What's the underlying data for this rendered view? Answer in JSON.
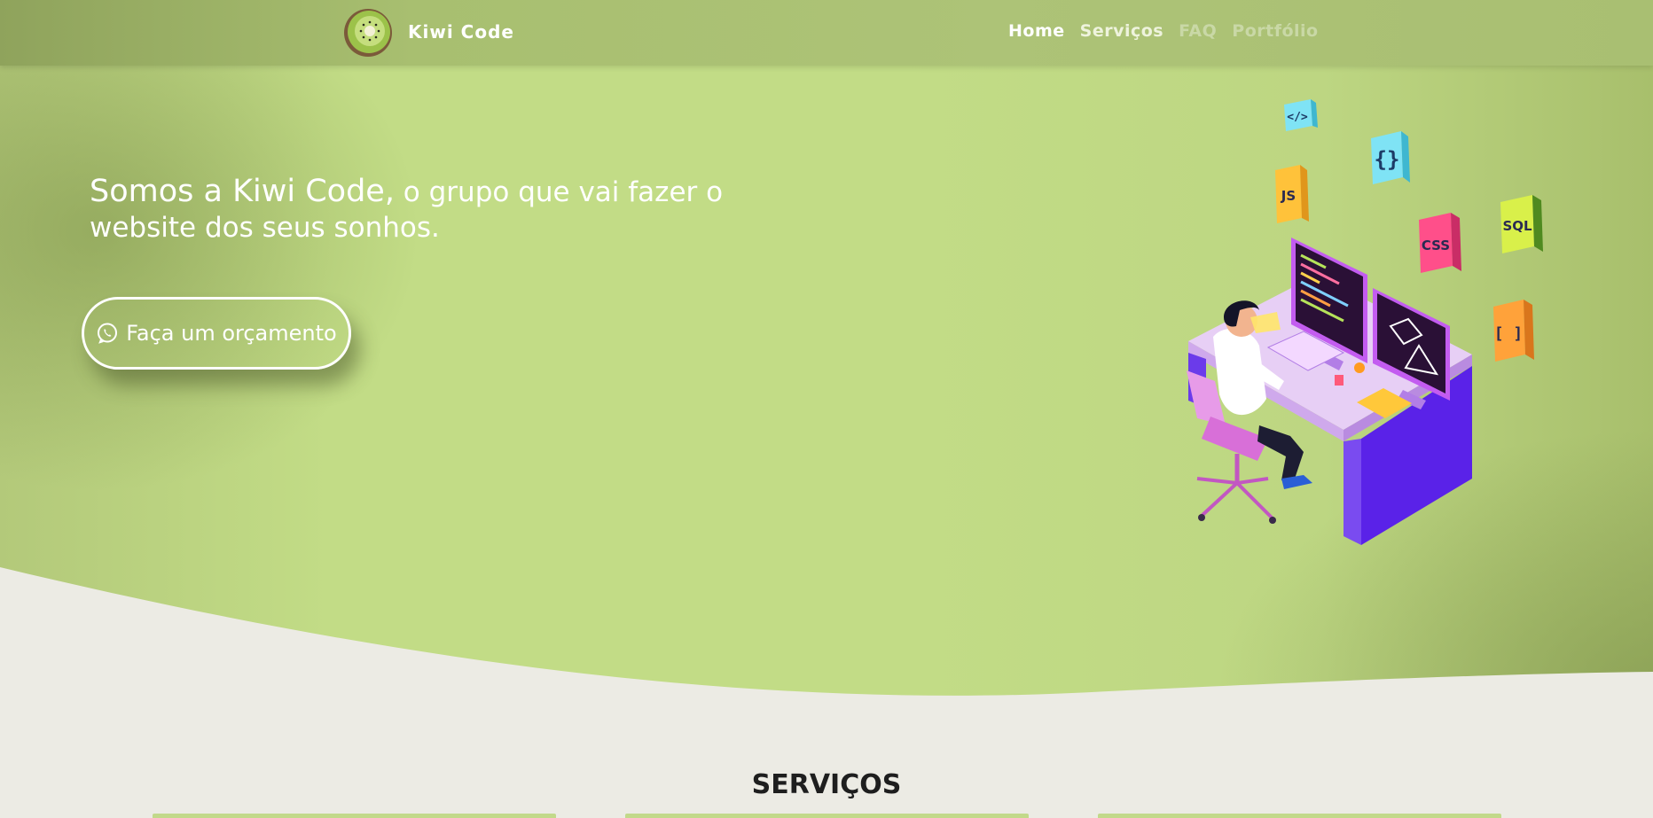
{
  "brand": {
    "name": "Kiwi Code"
  },
  "nav": {
    "items": [
      {
        "label": "Home",
        "state": "active"
      },
      {
        "label": "Serviços",
        "state": "normal"
      },
      {
        "label": "FAQ",
        "state": "muted"
      },
      {
        "label": "Portfólio",
        "state": "muted"
      }
    ]
  },
  "hero": {
    "headline_strong": "Somos a Kiwi Code,",
    "headline_rest": " o grupo que vai fazer o website dos seus sonhos.",
    "cta_label": "Faça um orçamento",
    "cta_icon": "whatsapp-icon"
  },
  "illustration": {
    "tags": [
      "</>",
      "{}",
      "JS",
      "CSS",
      "SQL",
      "[ ]"
    ]
  },
  "services": {
    "title": "SERVIÇOS"
  },
  "colors": {
    "hero_green": "#c2dc86",
    "nav_green": "#adc377",
    "page_bg": "#ecebe4",
    "text_white": "#ffffff"
  }
}
